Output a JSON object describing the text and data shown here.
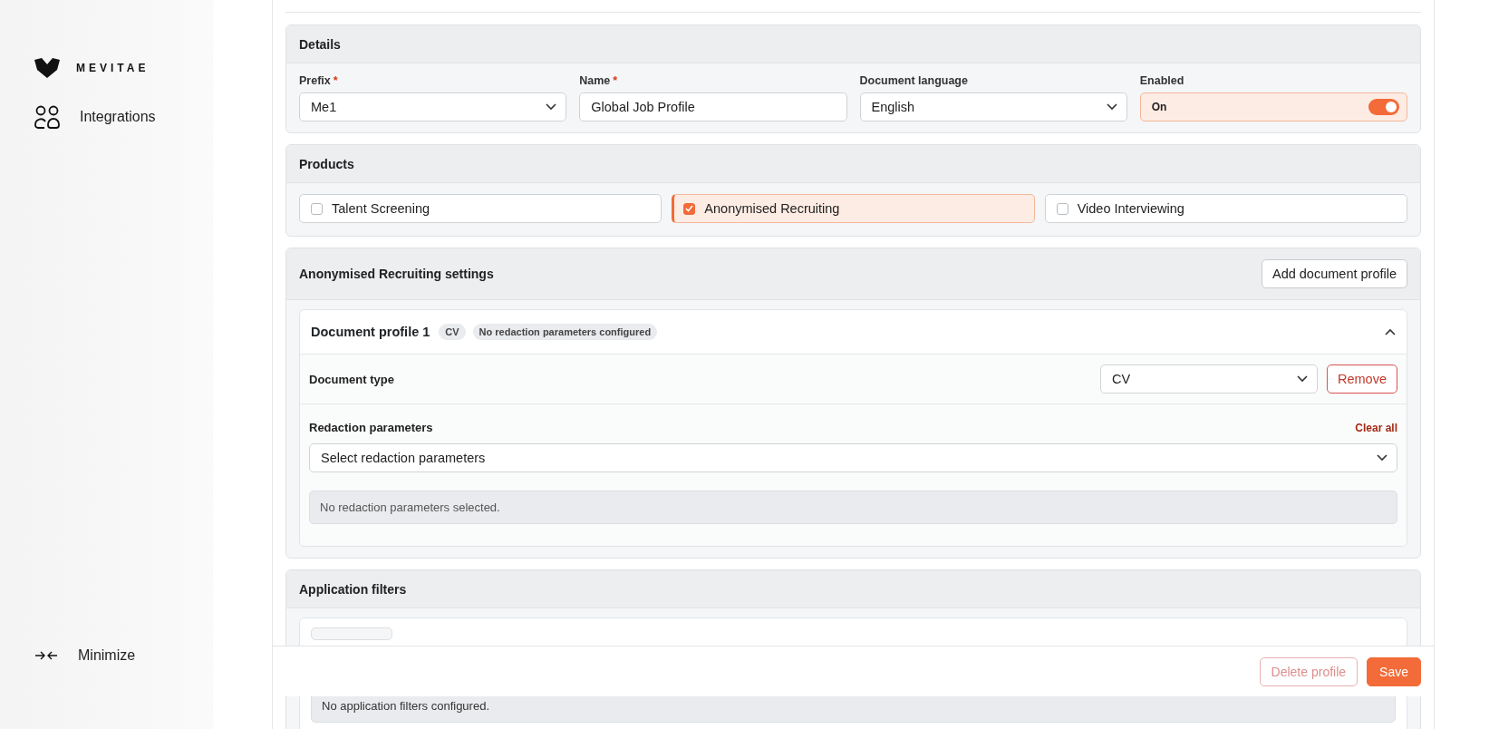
{
  "sidebar": {
    "logo": "MEVITAE",
    "items": [
      {
        "label": "Integrations",
        "selected": false
      }
    ],
    "minimize": "Minimize"
  },
  "details": {
    "title": "Details",
    "fields": [
      {
        "kind": "select",
        "label": "Prefix",
        "marker": "*",
        "value": "Me1"
      },
      {
        "kind": "text",
        "label": "Name",
        "marker": "*",
        "value": "Global Job Profile"
      },
      {
        "kind": "select",
        "label": "Document language",
        "value": "English"
      },
      {
        "kind": "toggle",
        "label": "Enabled",
        "value": "On",
        "on": true
      }
    ]
  },
  "products": {
    "title": "Products",
    "items": [
      {
        "label": "Talent Screening",
        "checked": false
      },
      {
        "label": "Anonymised Recruiting",
        "checked": true
      },
      {
        "label": "Video Interviewing",
        "checked": false
      }
    ]
  },
  "settings": {
    "title": "Anonymised Recruiting settings",
    "add_button": "Add document profile",
    "profiles": [
      {
        "title": "Document profile 1",
        "badges": [
          "CV",
          "No redaction parameters configured"
        ],
        "expanded": true,
        "document_type_label": "Document type",
        "document_type": "CV",
        "remove_button": "Remove",
        "redaction_label": "Redaction parameters",
        "clear_all": "Clear all",
        "redaction_placeholder": "Select redaction parameters",
        "empty_message": "No redaction parameters selected."
      }
    ]
  },
  "application_filters": {
    "title": "Application filters",
    "empty_message": "No application filters configured."
  },
  "footer": {
    "delete_button": "Delete profile",
    "save_button": "Save"
  }
}
